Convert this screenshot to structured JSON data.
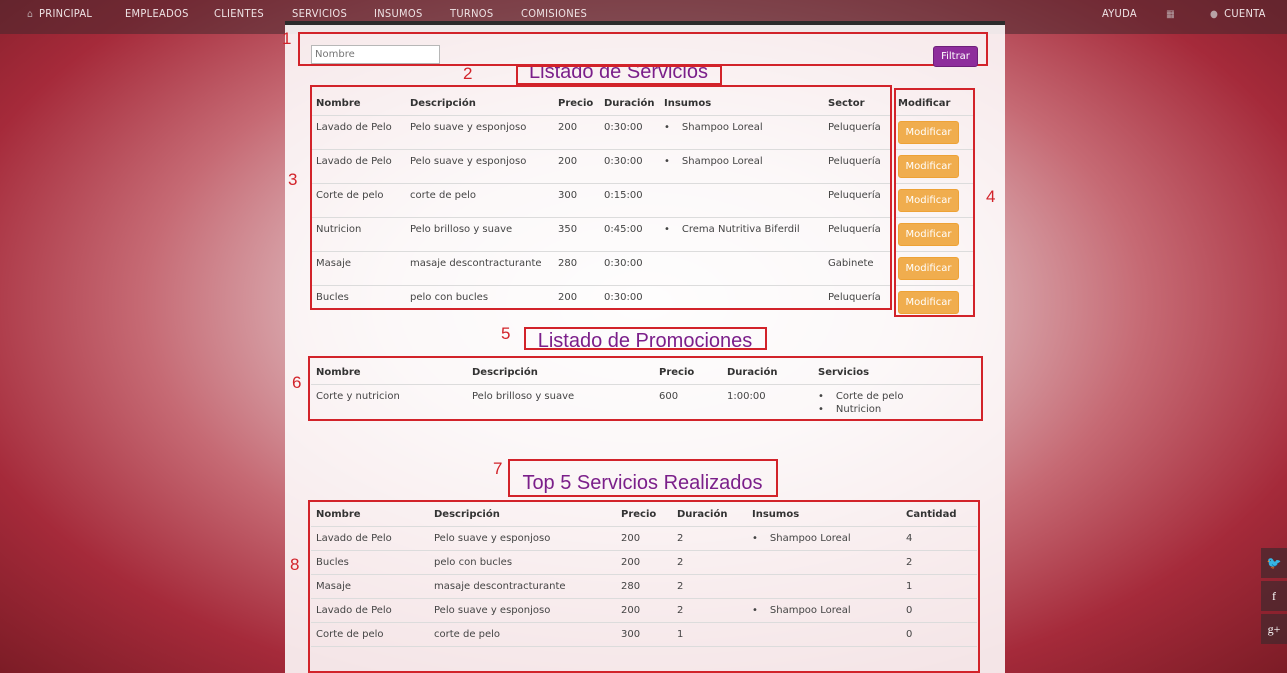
{
  "nav": {
    "left": [
      {
        "label": "PRINCIPAL",
        "icon": "home-icon"
      },
      {
        "label": "EMPLEADOS"
      },
      {
        "label": "CLIENTES"
      },
      {
        "label": "SERVICIOS"
      },
      {
        "label": "INSUMOS"
      },
      {
        "label": "TURNOS"
      },
      {
        "label": "COMISIONES"
      }
    ],
    "right": [
      {
        "label": "AYUDA"
      },
      {
        "label": "",
        "icon": "calendar-icon"
      },
      {
        "label": "CUENTA",
        "icon": "user-icon"
      }
    ]
  },
  "filter": {
    "placeholder": "Nombre",
    "button": "Filtrar"
  },
  "markers": [
    "1",
    "2",
    "3",
    "4",
    "5",
    "6",
    "7",
    "8"
  ],
  "services": {
    "title": "Listado de Servicios",
    "headers": [
      "Nombre",
      "Descripción",
      "Precio",
      "Duración",
      "Insumos",
      "Sector"
    ],
    "modify_header": "Modificar",
    "modify_label": "Modificar",
    "rows": [
      {
        "nombre": "Lavado de Pelo",
        "descripcion": "Pelo suave y esponjoso",
        "precio": "200",
        "duracion": "0:30:00",
        "insumos": "Shampoo Loreal",
        "sector": "Peluquería"
      },
      {
        "nombre": "Lavado de Pelo",
        "descripcion": "Pelo suave y esponjoso",
        "precio": "200",
        "duracion": "0:30:00",
        "insumos": "Shampoo Loreal",
        "sector": "Peluquería"
      },
      {
        "nombre": "Corte de pelo",
        "descripcion": "corte de pelo",
        "precio": "300",
        "duracion": "0:15:00",
        "insumos": "",
        "sector": "Peluquería"
      },
      {
        "nombre": "Nutricion",
        "descripcion": "Pelo brilloso y suave",
        "precio": "350",
        "duracion": "0:45:00",
        "insumos": "Crema Nutritiva Biferdil",
        "sector": "Peluquería"
      },
      {
        "nombre": "Masaje",
        "descripcion": "masaje descontracturante",
        "precio": "280",
        "duracion": "0:30:00",
        "insumos": "",
        "sector": "Gabinete"
      },
      {
        "nombre": "Bucles",
        "descripcion": "pelo con bucles",
        "precio": "200",
        "duracion": "0:30:00",
        "insumos": "",
        "sector": "Peluquería"
      }
    ]
  },
  "promotions": {
    "title": "Listado de Promociones",
    "headers": [
      "Nombre",
      "Descripción",
      "Precio",
      "Duración",
      "Servicios"
    ],
    "rows": [
      {
        "nombre": "Corte y nutricion",
        "descripcion": "Pelo brilloso y suave",
        "precio": "600",
        "duracion": "1:00:00",
        "servicios": [
          "Corte de pelo",
          "Nutricion"
        ]
      }
    ]
  },
  "top5": {
    "title": "Top 5 Servicios Realizados",
    "headers": [
      "Nombre",
      "Descripción",
      "Precio",
      "Duración",
      "Insumos",
      "Cantidad"
    ],
    "rows": [
      {
        "nombre": "Lavado de Pelo",
        "descripcion": "Pelo suave y esponjoso",
        "precio": "200",
        "duracion": "2",
        "insumos": "Shampoo Loreal",
        "cantidad": "4"
      },
      {
        "nombre": "Bucles",
        "descripcion": "pelo con bucles",
        "precio": "200",
        "duracion": "2",
        "insumos": "",
        "cantidad": "2"
      },
      {
        "nombre": "Masaje",
        "descripcion": "masaje descontracturante",
        "precio": "280",
        "duracion": "2",
        "insumos": "",
        "cantidad": "1"
      },
      {
        "nombre": "Lavado de Pelo",
        "descripcion": "Pelo suave y esponjoso",
        "precio": "200",
        "duracion": "2",
        "insumos": "Shampoo Loreal",
        "cantidad": "0"
      },
      {
        "nombre": "Corte de pelo",
        "descripcion": "corte de pelo",
        "precio": "300",
        "duracion": "1",
        "insumos": "",
        "cantidad": "0"
      }
    ]
  },
  "social": [
    {
      "icon": "twitter-icon",
      "glyph": "🐦"
    },
    {
      "icon": "facebook-icon",
      "glyph": "f"
    },
    {
      "icon": "googleplus-icon",
      "glyph": "g+"
    }
  ],
  "colors": {
    "accent": "#7b1f8a",
    "annotation": "#d2232a",
    "modify": "#f0ad4e",
    "filter": "#8e2d9c"
  }
}
